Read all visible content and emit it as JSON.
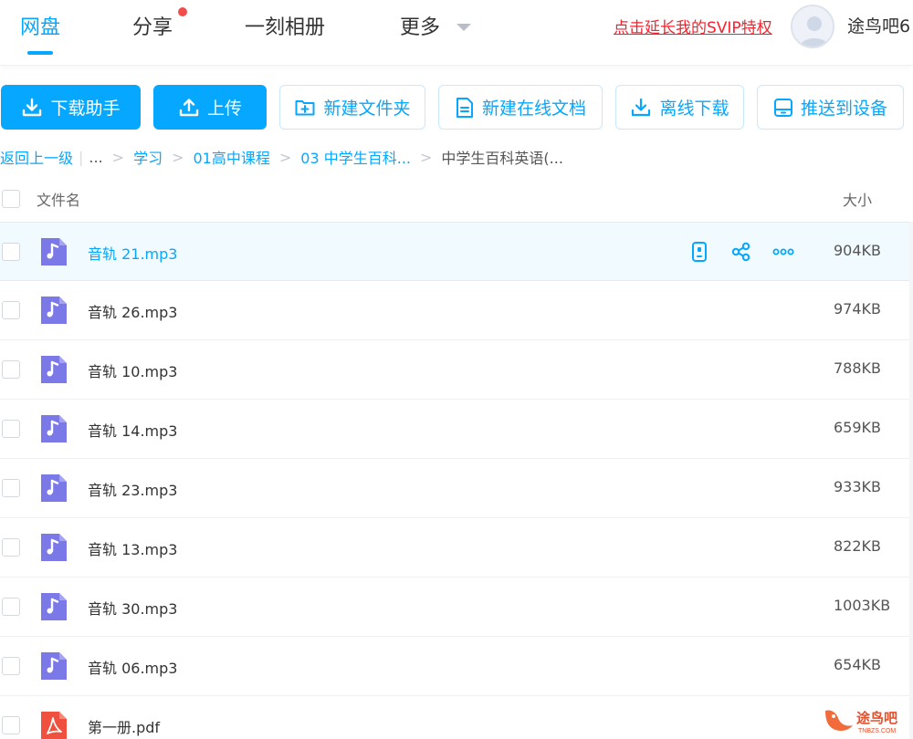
{
  "nav": {
    "tabs": [
      {
        "label": "网盘",
        "active": true
      },
      {
        "label": "分享",
        "has_dot": true
      },
      {
        "label": "一刻相册"
      },
      {
        "label": "更多"
      }
    ],
    "svip_link": "点击延长我的SVIP特权",
    "username": "途鸟吧6",
    "accent_color": "#06a7ff",
    "dot_color": "#f24d4d"
  },
  "toolbar": {
    "download_helper": "下载助手",
    "upload": "上传",
    "new_folder": "新建文件夹",
    "new_online_doc": "新建在线文档",
    "offline_download": "离线下载",
    "push_to_device": "推送到设备"
  },
  "breadcrumb": {
    "back": "返回上一级",
    "ellipsis": "...",
    "items": [
      "学习",
      "01高中课程",
      "03 中学生百科..."
    ],
    "current": "中学生百科英语(..."
  },
  "list": {
    "header_name": "文件名",
    "header_size": "大小",
    "files": [
      {
        "name": "音轨 21.mp3",
        "size": "904KB",
        "type": "audio",
        "hover": true
      },
      {
        "name": "音轨 26.mp3",
        "size": "974KB",
        "type": "audio"
      },
      {
        "name": "音轨 10.mp3",
        "size": "788KB",
        "type": "audio"
      },
      {
        "name": "音轨 14.mp3",
        "size": "659KB",
        "type": "audio"
      },
      {
        "name": "音轨 23.mp3",
        "size": "933KB",
        "type": "audio"
      },
      {
        "name": "音轨 13.mp3",
        "size": "822KB",
        "type": "audio"
      },
      {
        "name": "音轨 30.mp3",
        "size": "1003KB",
        "type": "audio"
      },
      {
        "name": "音轨 06.mp3",
        "size": "654KB",
        "type": "audio"
      },
      {
        "name": "第一册.pdf",
        "size": "",
        "type": "pdf"
      }
    ],
    "row_actions": [
      "phone-icon",
      "share-icon",
      "more-icon"
    ]
  },
  "watermark": {
    "text": "途鸟吧",
    "subtext": "TNBZS.COM"
  },
  "colors": {
    "audio_icon": "#7b79e8",
    "pdf_icon": "#f0503e",
    "svip_red": "#f5222d"
  }
}
